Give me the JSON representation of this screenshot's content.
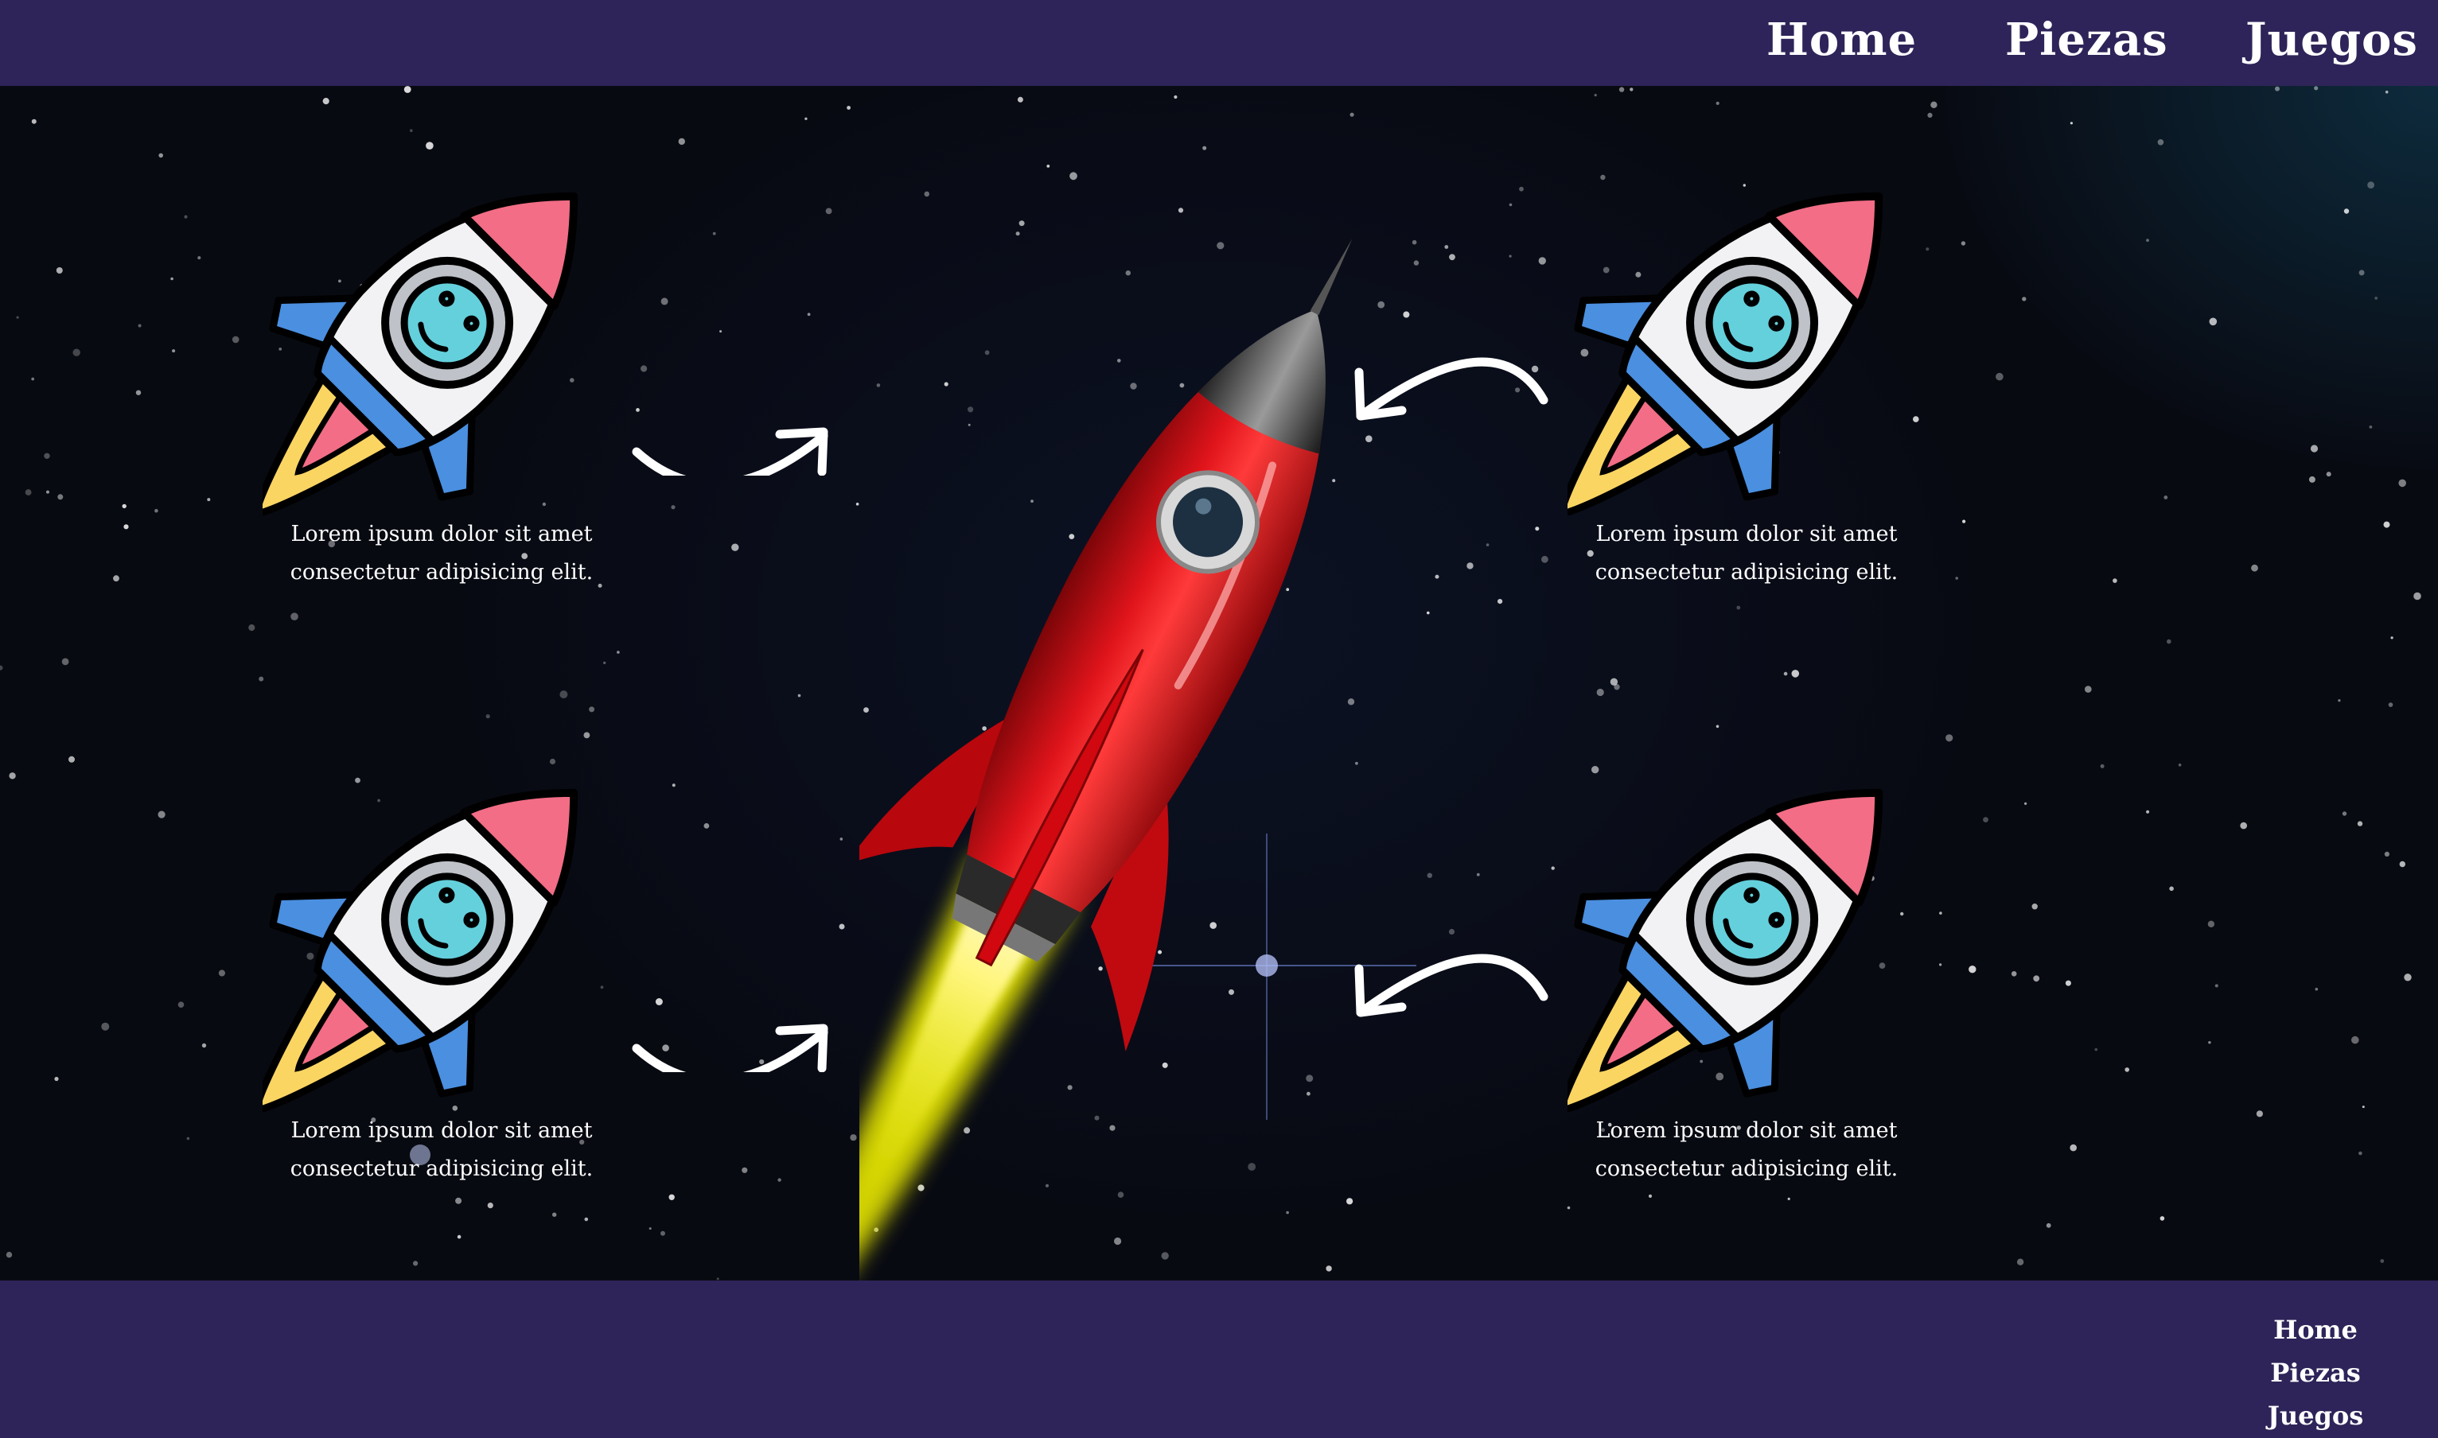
{
  "nav": {
    "items": [
      {
        "label": "Home"
      },
      {
        "label": "Piezas"
      },
      {
        "label": "Juegos"
      }
    ]
  },
  "hero": {
    "cards": [
      {
        "caption_line1": "Lorem ipsum dolor sit amet",
        "caption_line2": "consectetur adipisicing elit.",
        "icon": "cartoon-rocket-icon"
      },
      {
        "caption_line1": "Lorem ipsum dolor sit amet",
        "caption_line2": "consectetur adipisicing elit.",
        "icon": "cartoon-rocket-icon"
      },
      {
        "caption_line1": "Lorem ipsum dolor sit amet",
        "caption_line2": "consectetur adipisicing elit.",
        "icon": "cartoon-rocket-icon"
      },
      {
        "caption_line1": "Lorem ipsum dolor sit amet",
        "caption_line2": "consectetur adipisicing elit.",
        "icon": "cartoon-rocket-icon"
      }
    ],
    "main_image": "red-rocket-launch-illustration"
  },
  "footer": {
    "items": [
      {
        "label": "Home"
      },
      {
        "label": "Piezas"
      },
      {
        "label": "Juegos"
      }
    ]
  },
  "colors": {
    "nav_background": "#2e2459",
    "space_background": "#0a0c14",
    "text": "#ffffff",
    "rocket_red": "#d8121a",
    "flame_yellow": "#f8f22a"
  }
}
